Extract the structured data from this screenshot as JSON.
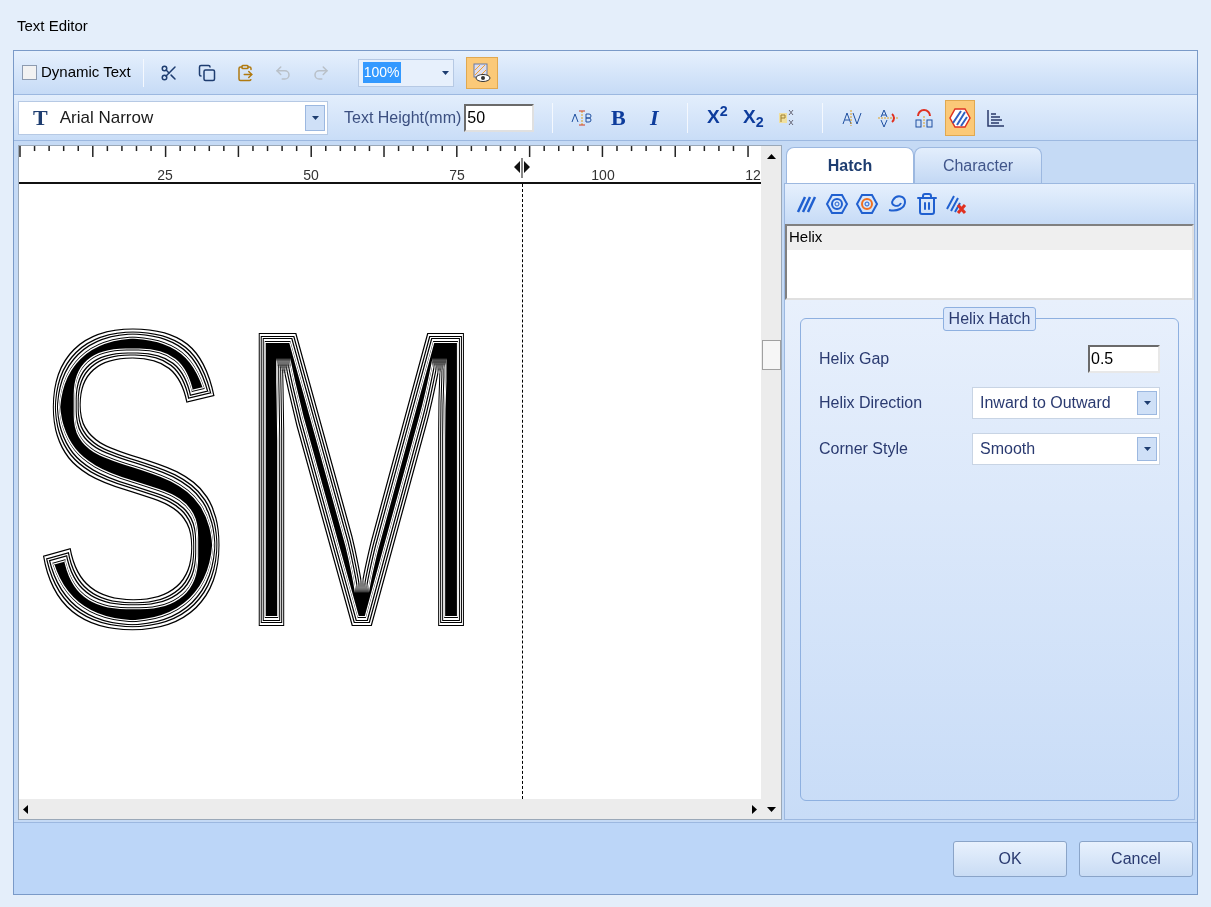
{
  "window": {
    "title": "Text Editor"
  },
  "toolbar": {
    "dynamic_text": {
      "label": "Dynamic Text",
      "checked": false
    },
    "edit_buttons": [
      {
        "kind": "cut",
        "disabled": false
      },
      {
        "kind": "copy",
        "disabled": false
      },
      {
        "kind": "paste",
        "disabled": false
      },
      {
        "kind": "undo",
        "disabled": true
      },
      {
        "kind": "redo",
        "disabled": true
      }
    ],
    "zoom": "100%",
    "preview_selected": true
  },
  "format_bar": {
    "font_icon": "T",
    "font": "Arial Narrow",
    "height_label": "Text Height(mm)",
    "height_value": "50",
    "groups": [
      [
        {
          "kind": "char-spacing",
          "selected": false
        },
        {
          "kind": "bold",
          "text": "B",
          "selected": false
        },
        {
          "kind": "italic",
          "text": "I",
          "selected": false
        }
      ],
      [
        {
          "kind": "superscript",
          "text": "X$^{2}$",
          "selected": false
        },
        {
          "kind": "subscript",
          "text": "X$_{2}$",
          "selected": false
        },
        {
          "kind": "script",
          "selected": false
        }
      ],
      [
        {
          "kind": "kerning",
          "selected": false
        },
        {
          "kind": "vertical",
          "selected": false
        },
        {
          "kind": "reverse",
          "selected": false
        },
        {
          "kind": "hatch",
          "selected": true
        },
        {
          "kind": "align",
          "selected": false
        }
      ]
    ]
  },
  "ruler": {
    "labels": [
      "25",
      "50",
      "75",
      "100",
      "12"
    ]
  },
  "canvas": {
    "text": "SM"
  },
  "tabs": [
    {
      "label": "Hatch",
      "selected": true
    },
    {
      "label": "Character",
      "selected": false
    }
  ],
  "hatch_list": [
    {
      "label": "Helix",
      "selected": true
    }
  ],
  "group": {
    "title": "Helix Hatch",
    "fields": [
      {
        "kind": "input",
        "label": "Helix Gap",
        "value": "0.5"
      },
      {
        "kind": "select",
        "label": "Helix Direction",
        "value": "Inward to Outward"
      },
      {
        "kind": "select",
        "label": "Corner Style",
        "value": "Smooth"
      }
    ]
  },
  "buttons": [
    "OK",
    "Cancel"
  ]
}
